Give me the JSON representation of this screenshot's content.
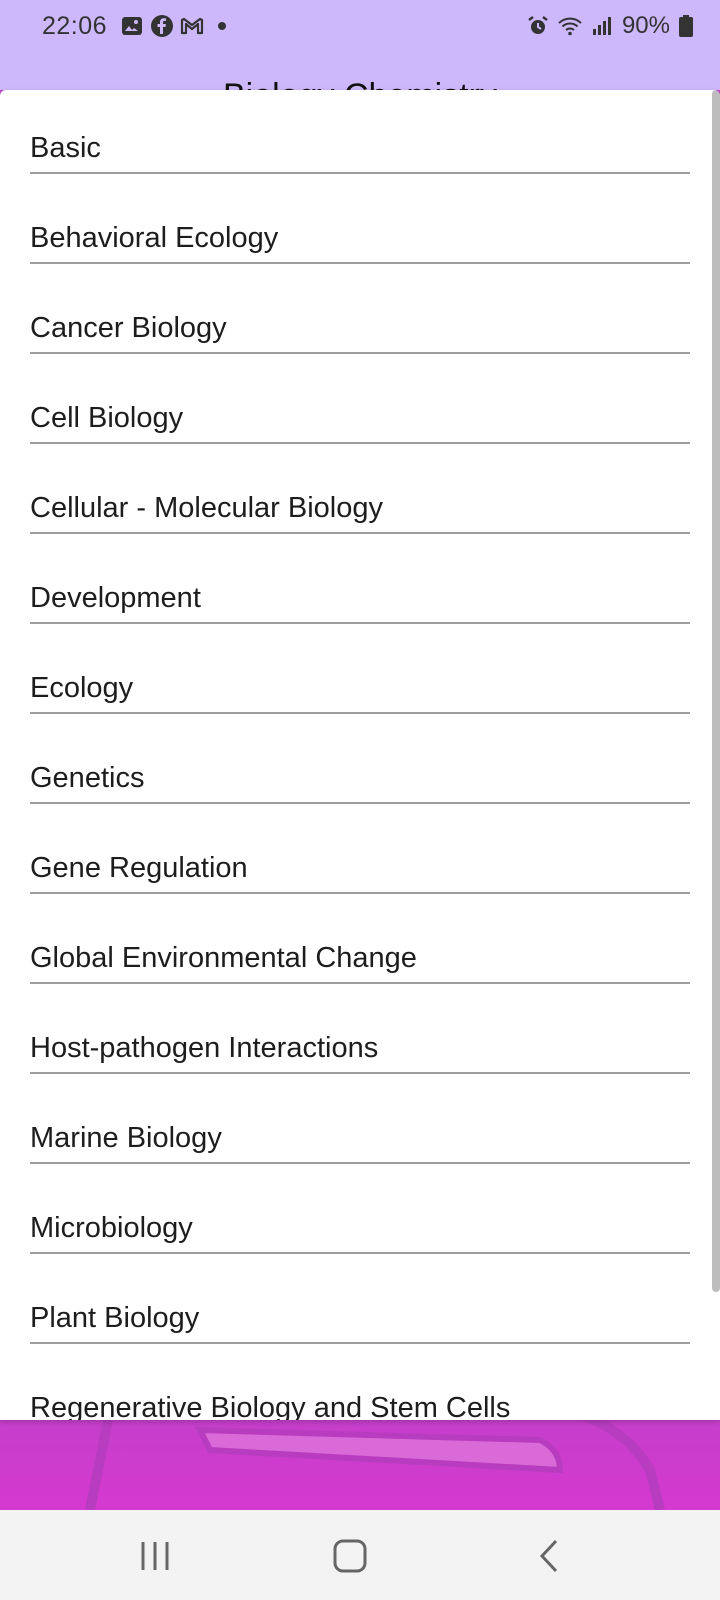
{
  "status_bar": {
    "time": "22:06",
    "notification_icons": [
      "gallery-icon",
      "facebook-icon",
      "gmail-icon",
      "dot-icon"
    ],
    "system_icons": [
      "alarm-icon",
      "wifi-icon",
      "signal-icon"
    ],
    "battery_percent": "90%"
  },
  "background_title": "Biology Chemistry",
  "dialog": {
    "options": [
      {
        "label": "Basic"
      },
      {
        "label": "Behavioral Ecology"
      },
      {
        "label": "Cancer Biology"
      },
      {
        "label": "Cell Biology"
      },
      {
        "label": "Cellular - Molecular Biology"
      },
      {
        "label": "Development"
      },
      {
        "label": "Ecology"
      },
      {
        "label": "Genetics"
      },
      {
        "label": "Gene Regulation"
      },
      {
        "label": "Global Environmental Change"
      },
      {
        "label": "Host-pathogen Interactions"
      },
      {
        "label": "Marine Biology"
      },
      {
        "label": "Microbiology"
      },
      {
        "label": "Plant Biology"
      },
      {
        "label": "Regenerative Biology and Stem Cells"
      }
    ]
  },
  "nav_bar": {
    "icons": [
      "recent-apps-icon",
      "home-icon",
      "back-icon"
    ]
  },
  "colors": {
    "status_bar": "#cdb8fb",
    "background": "#c24ac8",
    "divider": "#9e9e9e"
  }
}
